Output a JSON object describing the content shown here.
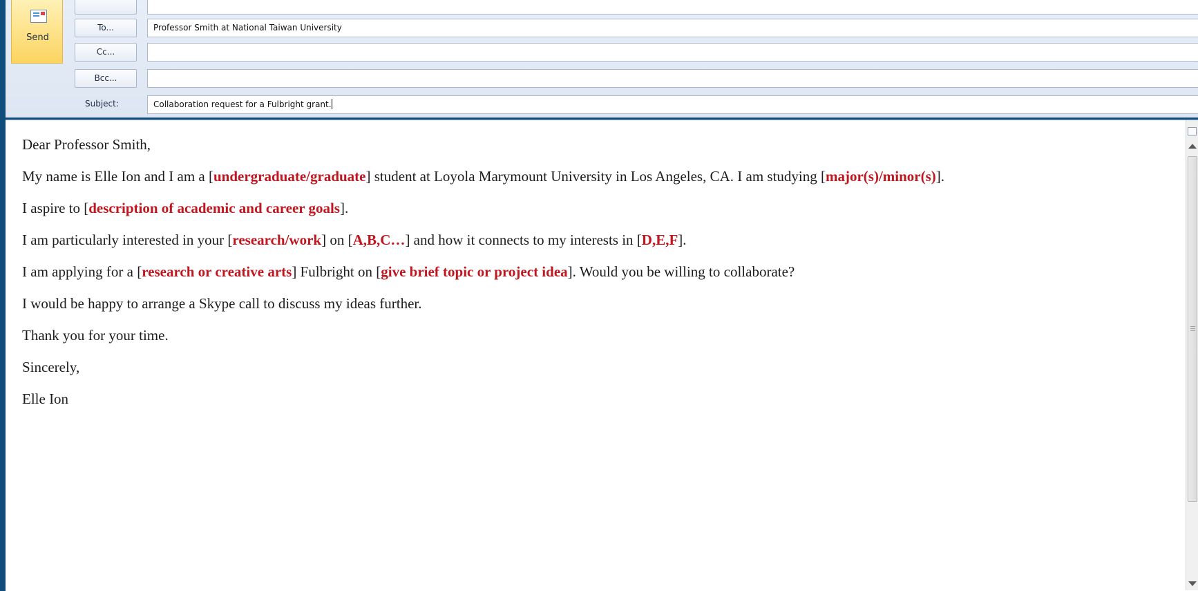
{
  "toolbar": {
    "send_label": "Send"
  },
  "fields": {
    "to_label": "To...",
    "to_value": "Professor Smith at National Taiwan University",
    "cc_label": "Cc...",
    "cc_value": "",
    "bcc_label": "Bcc...",
    "bcc_value": "",
    "subject_label": "Subject:",
    "subject_value": "Collaboration request for a Fulbright grant."
  },
  "message": {
    "greeting": "Dear Professor Smith,",
    "p1": {
      "a": "My name is Elle Ion and I am a [",
      "h1": "undergraduate/graduate",
      "b": "] student at Loyola Marymount University in Los Angeles, CA. I am studying [",
      "h2": "major(s)/minor(s)",
      "c": "]."
    },
    "p2": {
      "a": "I aspire to [",
      "h1": "description of academic and career goals",
      "b": "]."
    },
    "p3": {
      "a": "I am particularly interested in your [",
      "h1": "research/work",
      "b": "] on [",
      "h2": "A,B,C…",
      "c": "] and how it connects to my interests in [",
      "h3": "D,E,F",
      "d": "]."
    },
    "p4": {
      "a": "I am applying for a [",
      "h1": "research or creative arts",
      "b": "] Fulbright on [",
      "h2": "give brief topic or project idea",
      "c": "]. Would you be willing to collaborate?"
    },
    "p5": "I would be happy to arrange a Skype call to discuss my ideas further.",
    "p6": "Thank you for your time.",
    "closing": "Sincerely,",
    "signature": "Elle Ion"
  },
  "colors": {
    "placeholder_highlight": "#c0161f",
    "frame": "#0f4d7d",
    "send_button": "#fbd460"
  },
  "icons": {
    "send": "send-mail-icon",
    "ruler": "ruler-toggle-icon"
  }
}
